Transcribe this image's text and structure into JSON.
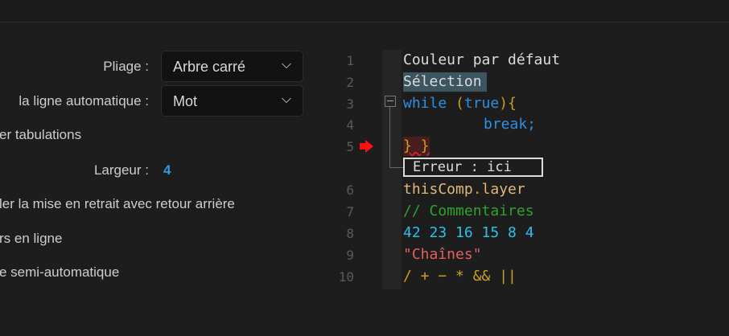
{
  "settings": {
    "folding_label": "Pliage :",
    "folding_value": "Arbre carré",
    "wrap_label": "la ligne automatique :",
    "wrap_value": "Mot",
    "tabs_label": "er tabulations",
    "width_label": "Largeur :",
    "width_value": "4",
    "backspace_label": "ler la mise en retrait avec retour arrière",
    "inline_label": "rs en ligne",
    "semi_label": "e semi-automatique"
  },
  "preview": {
    "line_numbers": [
      "1",
      "2",
      "3",
      "4",
      "5",
      "6",
      "7",
      "8",
      "9",
      "10"
    ],
    "line1": "Couleur par défaut",
    "line2": "Sélection",
    "line3_kw": "while",
    "line3_paren_open": " (",
    "line3_true": "true",
    "line3_rest": "){",
    "line4": "break;",
    "line5": "} }",
    "error": "Erreur : ici",
    "line6_a": "thisComp",
    "line6_dot": ".",
    "line6_b": "layer",
    "line7": "// Commentaires",
    "line8": "42 23 16 15 8 4",
    "line9": "\"Chaînes\"",
    "line10": "/ + − * && ||"
  },
  "colors": {
    "keyword": "#2f8fe0",
    "number": "#2cc0e8",
    "comment": "#2aa52a",
    "string": "#e06060",
    "operator": "#c8a020",
    "accent": "#2d9be8"
  }
}
